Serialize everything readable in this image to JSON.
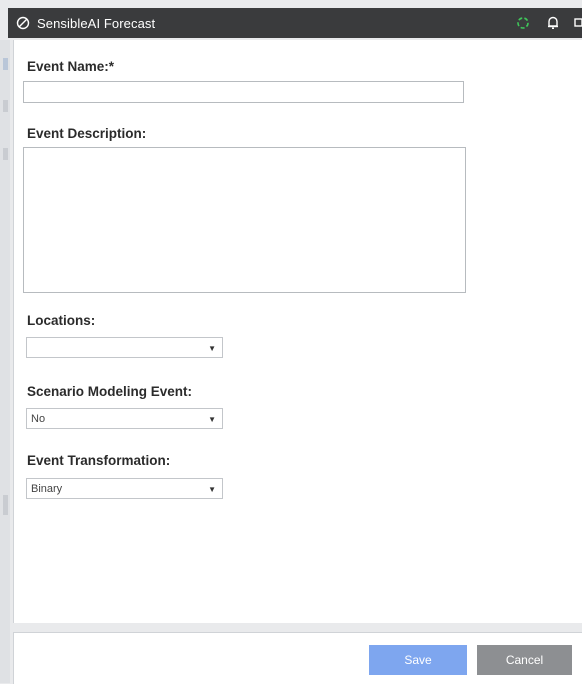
{
  "window": {
    "title": "SensibleAI Forecast",
    "icons": [
      "app-logo-icon",
      "refresh-icon",
      "notification-bell-icon",
      "window-icon"
    ]
  },
  "form": {
    "event_name_label": "Event Name:*",
    "event_name_value": "",
    "event_description_label": "Event Description:",
    "event_description_value": "",
    "locations_label": "Locations:",
    "locations_value": "",
    "scenario_label": "Scenario Modeling Event:",
    "scenario_value": "No",
    "transformation_label": "Event Transformation:",
    "transformation_value": "Binary"
  },
  "footer": {
    "save_label": "Save",
    "cancel_label": "Cancel"
  },
  "colors": {
    "titlebar": "#3a3b3d",
    "save_button": "#7ea6ef",
    "cancel_button": "#8d8f92"
  }
}
